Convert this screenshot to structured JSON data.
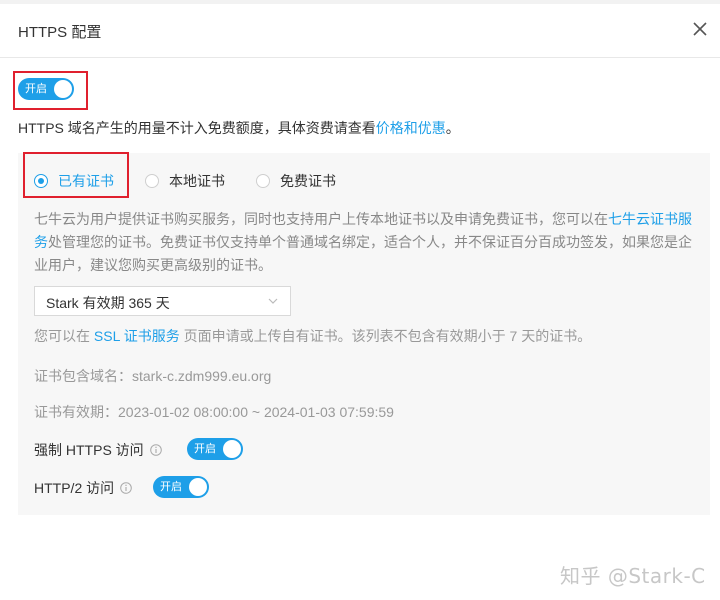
{
  "dialog": {
    "title": "HTTPS 配置",
    "close_icon": "close-icon"
  },
  "main_switch": {
    "label": "开启",
    "on": true
  },
  "description": {
    "text": "HTTPS 域名产生的用量不计入免费额度，具体资费请查看",
    "link": "价格和优惠",
    "tail": "。"
  },
  "cert_source": {
    "options": [
      "已有证书",
      "本地证书",
      "免费证书"
    ],
    "selected": "已有证书"
  },
  "cert_info": {
    "text1": "七牛云为用户提供证书购买服务，同时也支持用户上传本地证书以及申请免费证书，您可以在",
    "link": "七牛云证书服务",
    "text2": "处管理您的证书。免费证书仅支持单个普通域名绑定，适合个人，并不保证百分百成功签发，如果您是企业用户，建议您购买更高级别的证书。"
  },
  "cert_select": {
    "value": "Stark 有效期 365 天"
  },
  "ssl_hint": {
    "pre": "您可以在",
    "link": "SSL 证书服务",
    "post": "页面申请或上传自有证书。该列表不包含有效期小于 7 天的证书。"
  },
  "cert_domain": "证书包含域名：stark-c.zdm999.eu.org",
  "cert_validity": "证书有效期：2023-01-02 08:00:00 ~ 2024-01-03 07:59:59",
  "force_https": {
    "label": "强制 HTTPS 访问",
    "switch_label": "开启",
    "on": true
  },
  "http2": {
    "label": "HTTP/2 访问",
    "switch_label": "开启",
    "on": true
  },
  "watermark": "知乎 @Stark-C",
  "colors": {
    "accent": "#1e9fe8",
    "highlight": "#e0202e",
    "panel": "#f7f7f7"
  }
}
